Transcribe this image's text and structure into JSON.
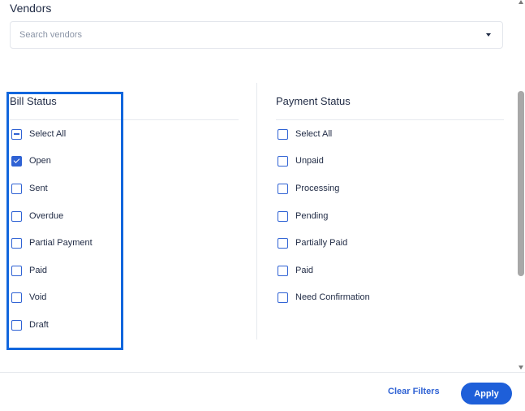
{
  "vendors": {
    "title": "Vendors",
    "search_placeholder": "Search vendors",
    "search_value": ""
  },
  "bill_status": {
    "title": "Bill Status",
    "options": [
      {
        "label": "Select All",
        "state": "indeterminate"
      },
      {
        "label": "Open",
        "state": "checked"
      },
      {
        "label": "Sent",
        "state": "unchecked"
      },
      {
        "label": "Overdue",
        "state": "unchecked"
      },
      {
        "label": "Partial Payment",
        "state": "unchecked"
      },
      {
        "label": "Paid",
        "state": "unchecked"
      },
      {
        "label": "Void",
        "state": "unchecked"
      },
      {
        "label": "Draft",
        "state": "unchecked"
      }
    ]
  },
  "payment_status": {
    "title": "Payment Status",
    "options": [
      {
        "label": "Select All",
        "state": "unchecked"
      },
      {
        "label": "Unpaid",
        "state": "unchecked"
      },
      {
        "label": "Processing",
        "state": "unchecked"
      },
      {
        "label": "Pending",
        "state": "unchecked"
      },
      {
        "label": "Partially Paid",
        "state": "unchecked"
      },
      {
        "label": "Paid",
        "state": "unchecked"
      },
      {
        "label": "Need Confirmation",
        "state": "unchecked"
      }
    ]
  },
  "footer": {
    "clear_label": "Clear Filters",
    "apply_label": "Apply"
  },
  "colors": {
    "accent": "#2f62d4",
    "apply_button": "#1e5fd9",
    "highlight_outline": "#1166dd",
    "text": "#1f2a44"
  }
}
